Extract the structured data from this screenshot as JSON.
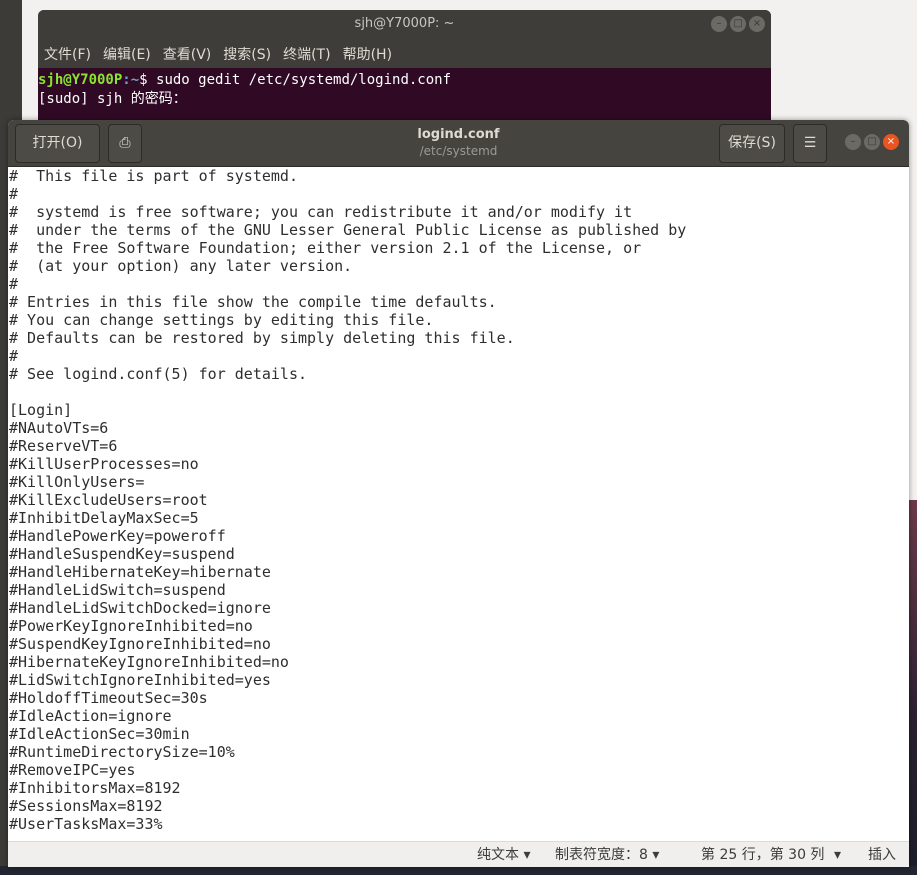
{
  "terminal": {
    "title": "sjh@Y7000P: ~",
    "menu": [
      "文件(F)",
      "编辑(E)",
      "查看(V)",
      "搜索(S)",
      "终端(T)",
      "帮助(H)"
    ],
    "prompt_user": "sjh@Y7000P",
    "prompt_path": ":~",
    "prompt_cmd": "$ sudo gedit /etc/systemd/logind.conf",
    "line2": "[sudo] sjh 的密码："
  },
  "gedit": {
    "open_label": "打开(O)",
    "title": "logind.conf",
    "subtitle": "/etc/systemd",
    "save_label": "保存(S)",
    "menu_icon": "☰",
    "lines": [
      "#  This file is part of systemd.",
      "#",
      "#  systemd is free software; you can redistribute it and/or modify it",
      "#  under the terms of the GNU Lesser General Public License as published by",
      "#  the Free Software Foundation; either version 2.1 of the License, or",
      "#  (at your option) any later version.",
      "#",
      "# Entries in this file show the compile time defaults.",
      "# You can change settings by editing this file.",
      "# Defaults can be restored by simply deleting this file.",
      "#",
      "# See logind.conf(5) for details.",
      "",
      "[Login]",
      "#NAutoVTs=6",
      "#ReserveVT=6",
      "#KillUserProcesses=no",
      "#KillOnlyUsers=",
      "#KillExcludeUsers=root",
      "#InhibitDelayMaxSec=5",
      "#HandlePowerKey=poweroff",
      "#HandleSuspendKey=suspend",
      "#HandleHibernateKey=hibernate",
      "#HandleLidSwitch=suspend",
      "#HandleLidSwitchDocked=ignore",
      "#PowerKeyIgnoreInhibited=no",
      "#SuspendKeyIgnoreInhibited=no",
      "#HibernateKeyIgnoreInhibited=no",
      "#LidSwitchIgnoreInhibited=yes",
      "#HoldoffTimeoutSec=30s",
      "#IdleAction=ignore",
      "#IdleActionSec=30min",
      "#RuntimeDirectorySize=10%",
      "#RemoveIPC=yes",
      "#InhibitorsMax=8192",
      "#SessionsMax=8192",
      "#UserTasksMax=33%"
    ],
    "status": {
      "syntax": "纯文本 ▾",
      "tab_width": "制表符宽度：8 ▾",
      "position": "第 25 行，第 30 列",
      "mode_arrow": "▾",
      "mode": "插入"
    }
  }
}
